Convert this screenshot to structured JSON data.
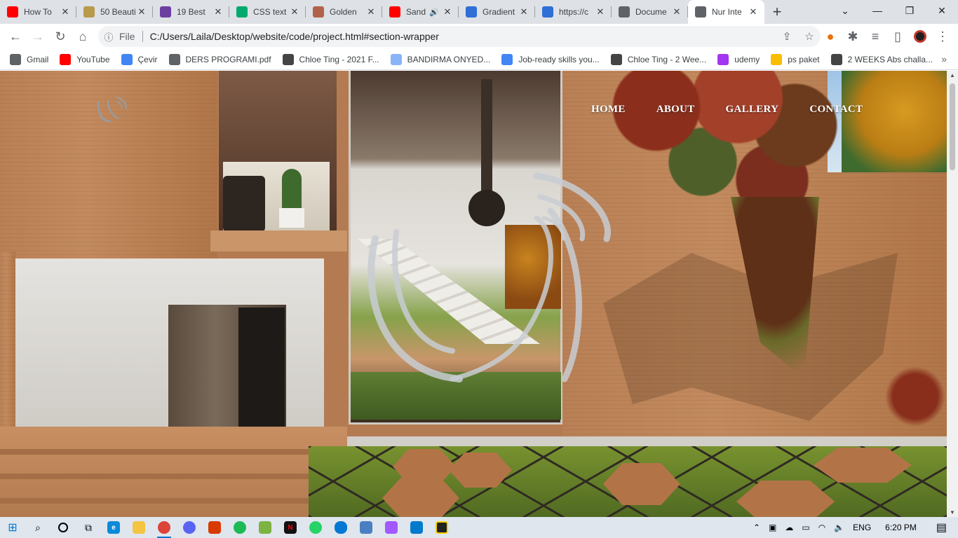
{
  "browser": {
    "tabs": [
      {
        "title": "How To",
        "favicon": "youtube-icon",
        "color": "#ff0000"
      },
      {
        "title": "50 Beauti",
        "favicon": "design-site-icon",
        "color": "#b89a4a"
      },
      {
        "title": "19 Best",
        "favicon": "colorlib-icon",
        "color": "#6b3fa0"
      },
      {
        "title": "CSS text",
        "favicon": "w3schools-icon",
        "color": "#04aa6d"
      },
      {
        "title": "Golden",
        "favicon": "page-icon",
        "color": "#b0634b"
      },
      {
        "title": "Sand",
        "favicon": "youtube-icon",
        "color": "#ff0000",
        "audio": true
      },
      {
        "title": "Gradient",
        "favicon": "cssgradient-icon",
        "color": "#2f6fd6"
      },
      {
        "title": "https://c",
        "favicon": "cssgradient-icon",
        "color": "#2f6fd6"
      },
      {
        "title": "Docume",
        "favicon": "globe-icon",
        "color": "#5f6368"
      },
      {
        "title": "Nur Inte",
        "favicon": "globe-icon",
        "color": "#5f6368",
        "active": true
      }
    ],
    "address": {
      "scheme": "File",
      "url": "C:/Users/Laila/Desktop/website/code/project.html#section-wrapper"
    },
    "bookmarks": [
      {
        "label": "Gmail",
        "icon": "globe-icon",
        "color": "#5f6368"
      },
      {
        "label": "YouTube",
        "icon": "youtube-icon",
        "color": "#ff0000"
      },
      {
        "label": "Çevir",
        "icon": "translate-icon",
        "color": "#4285f4"
      },
      {
        "label": "DERS PROGRAMI.pdf",
        "icon": "globe-icon",
        "color": "#5f6368"
      },
      {
        "label": "Chloe Ting - 2021 F...",
        "icon": "avatar-icon",
        "color": "#444444"
      },
      {
        "label": "BANDIRMA ONYED...",
        "icon": "university-icon",
        "color": "#8ab4f8"
      },
      {
        "label": "Job-ready skills you...",
        "icon": "google-icon",
        "color": "#4285f4"
      },
      {
        "label": "Chloe Ting - 2 Wee...",
        "icon": "avatar-icon",
        "color": "#444444"
      },
      {
        "label": "udemy",
        "icon": "udemy-icon",
        "color": "#a435f0"
      },
      {
        "label": "ps paket",
        "icon": "drive-icon",
        "color": "#fbbc04"
      },
      {
        "label": "2 WEEKS Abs challa...",
        "icon": "avatar-icon",
        "color": "#444444"
      }
    ],
    "more_bookmarks": "»"
  },
  "site": {
    "nav": [
      "HOME",
      "ABOUT",
      "GALLERY",
      "CONTACT"
    ]
  },
  "taskbar": {
    "language": "ENG",
    "time": "6:20 PM"
  }
}
